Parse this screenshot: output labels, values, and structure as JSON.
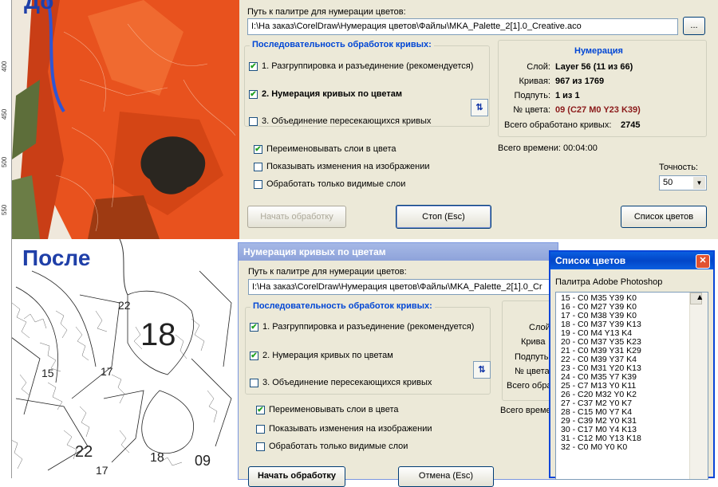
{
  "top_image": {
    "label": "До",
    "ruler": [
      "400",
      "450",
      "500",
      "550"
    ]
  },
  "bottom_image": {
    "label": "После",
    "region_numbers": [
      "18",
      "22",
      "22",
      "15",
      "17",
      "09",
      "18",
      "17"
    ]
  },
  "dialog1": {
    "path_label": "Путь к палитре для нумерации цветов:",
    "path_value": "I:\\На заказ\\CorelDraw\\Нумерация цветов\\Файлы\\MKA_Palette_2[1].0_Creative.aco",
    "browse_label": "...",
    "sequence_title": "Последовательность обработок кривых:",
    "steps": [
      {
        "label": "1. Разгруппировка и разъединение (рекомендуется)",
        "checked": true
      },
      {
        "label": "2. Нумерация кривых по цветам",
        "checked": true
      },
      {
        "label": "3. Объединение пересекающихся кривых",
        "checked": false
      }
    ],
    "swap_label": "⇅",
    "numbering": {
      "title": "Нумерация",
      "rows": [
        {
          "key": "Слой:",
          "value": "Layer 56 (11 из 66)"
        },
        {
          "key": "Кривая:",
          "value": "967 из 1769"
        },
        {
          "key": "Подпуть:",
          "value": "1 из 1"
        },
        {
          "key": "№ цвета:",
          "value": "09 (C27 M0 Y23 K39)"
        }
      ],
      "total_label": "Всего обработано кривых:",
      "total_value": "2745"
    },
    "options": [
      {
        "label": "Переименовывать слои в цвета",
        "checked": true
      },
      {
        "label": "Показывать изменения на изображении",
        "checked": false
      },
      {
        "label": "Обработать только видимые слои",
        "checked": false
      }
    ],
    "time_label": "Всего времени:",
    "time_value": "00:04:00",
    "precision_label": "Точность:",
    "precision_value": "50",
    "start_button": "Начать обработку",
    "stop_button": "Стоп (Esc)",
    "colors_button": "Список цветов"
  },
  "dialog2": {
    "title": "Нумерация кривых по цветам",
    "path_label": "Путь к палитре для нумерации цветов:",
    "path_value": "I:\\На заказ\\CorelDraw\\Нумерация цветов\\Файлы\\MKA_Palette_2[1].0_Cr",
    "sequence_title": "Последовательность обработок кривых:",
    "steps": [
      {
        "label": "1. Разгруппировка и разъединение (рекомендуется)",
        "checked": true
      },
      {
        "label": "2. Нумерация кривых по цветам",
        "checked": true
      },
      {
        "label": "3. Объединение пересекающихся кривых",
        "checked": false
      }
    ],
    "swap_label": "⇅",
    "info_keys": [
      "Слой",
      "Крива",
      "Подпуть",
      "№ цвета",
      "Всего обра"
    ],
    "time_label": "Всего време",
    "options": [
      {
        "label": "Переименовывать слои в цвета",
        "checked": true
      },
      {
        "label": "Показывать изменения на изображении",
        "checked": false
      },
      {
        "label": "Обработать только видимые слои",
        "checked": false
      }
    ],
    "start_button": "Начать обработку",
    "cancel_button": "Отмена (Esc)"
  },
  "color_list": {
    "title": "Список цветов",
    "close_label": "✕",
    "palette_label": "Палитра Adobe Photoshop",
    "items": [
      "15 - C0 M35 Y39 K0",
      "16 - C0 M27 Y39 K0",
      "17 - C0 M38 Y39 K0",
      "18 - C0 M37 Y39 K13",
      "19 - C0 M4 Y13 K4",
      "20 - C0 M37 Y35 K23",
      "21 - C0 M39 Y31 K29",
      "22 - C0 M39 Y37 K4",
      "23 - C0 M31 Y20 K13",
      "24 - C0 M35 Y7 K39",
      "25 - C7 M13 Y0 K11",
      "26 - C20 M32 Y0 K2",
      "27 - C37 M2 Y0 K7",
      "28 - C15 M0 Y7 K4",
      "29 - C39 M2 Y0 K31",
      "30 - C17 M0 Y4 K13",
      "31 - C12 M0 Y13 K18",
      "32 - C0 M0 Y0 K0"
    ]
  },
  "colors": {
    "accent": "#0046d5",
    "dialog_bg": "#ece9d8",
    "poppy": "#e8521e",
    "label_blue": "#1f3fa8"
  }
}
